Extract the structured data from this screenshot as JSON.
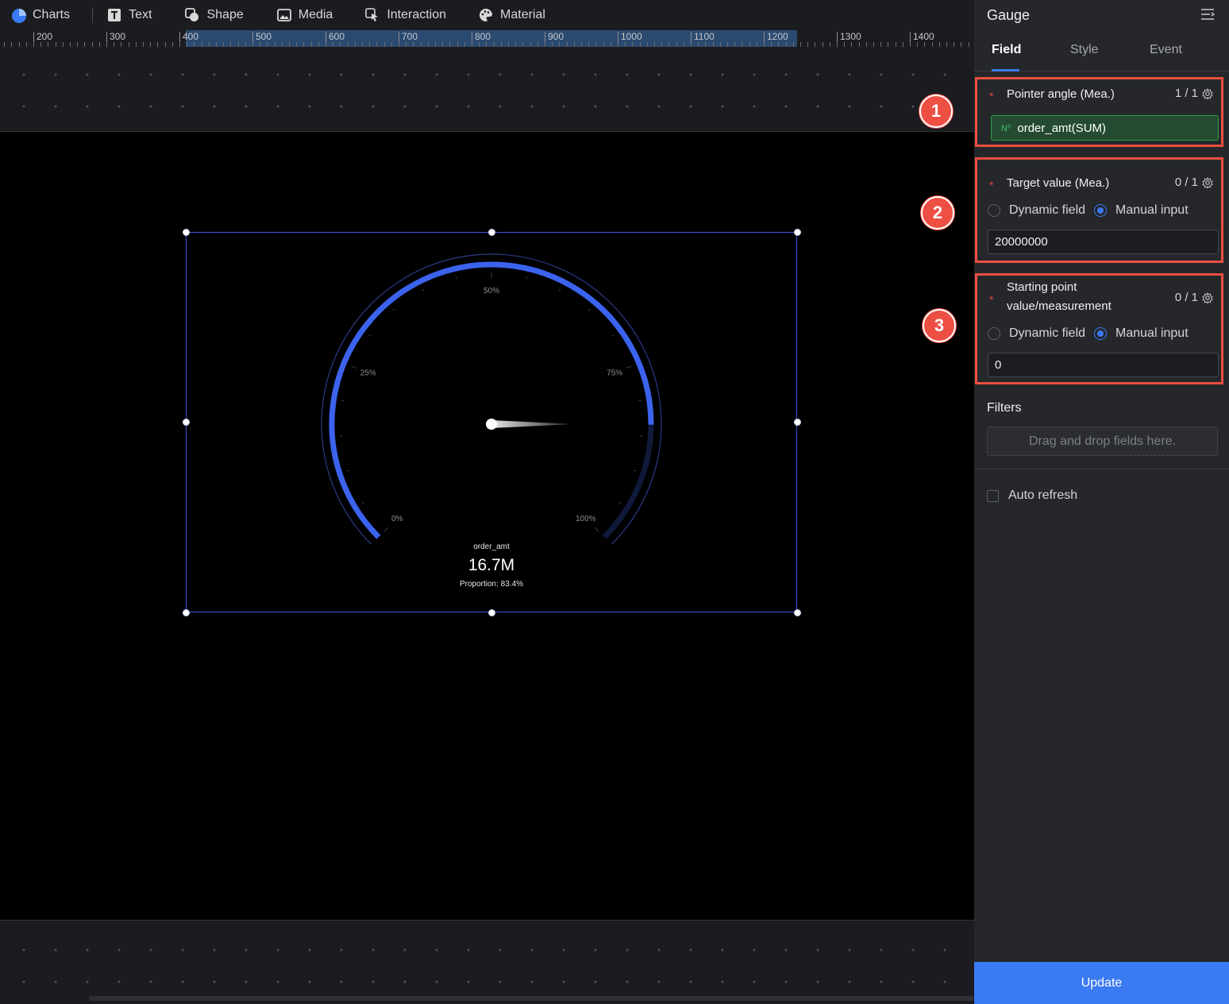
{
  "toolbar": {
    "items": [
      {
        "label": "Charts",
        "icon": "pie-chart-icon"
      },
      {
        "label": "Text",
        "icon": "text-icon"
      },
      {
        "label": "Shape",
        "icon": "shape-icon"
      },
      {
        "label": "Media",
        "icon": "image-icon"
      },
      {
        "label": "Interaction",
        "icon": "cursor-icon"
      },
      {
        "label": "Material",
        "icon": "palette-icon"
      }
    ]
  },
  "ruler": {
    "labels": [
      "200",
      "300",
      "400",
      "500",
      "600",
      "700",
      "800",
      "900",
      "1000",
      "1100",
      "1200",
      "1300",
      "1400"
    ]
  },
  "chart_data": {
    "type": "gauge",
    "title": "order_amt",
    "value_label": "16.7M",
    "proportion_label": "Proportion: 83.4%",
    "proportion": 0.834,
    "tick_labels": [
      "0%",
      "25%",
      "50%",
      "75%",
      "100%"
    ],
    "colors": {
      "progress": "#3b63ee",
      "track": "#0f1a3a",
      "outer_ring": "#2a3a8a"
    }
  },
  "badges": [
    "1",
    "2",
    "3"
  ],
  "panel": {
    "title": "Gauge",
    "tabs": [
      {
        "label": "Field",
        "active": true
      },
      {
        "label": "Style",
        "active": false
      },
      {
        "label": "Event",
        "active": false
      }
    ],
    "pointer": {
      "title": "Pointer angle (Mea.)",
      "count": "1 / 1",
      "field_prefix": "N⁰",
      "field": "order_amt(SUM)"
    },
    "target": {
      "title": "Target value (Mea.)",
      "count": "0 / 1",
      "option_dynamic": "Dynamic field",
      "option_manual": "Manual input",
      "selected": "Manual input",
      "value": "20000000"
    },
    "start": {
      "title_line1": "Starting point",
      "title_line2": "value/measurement",
      "count": "0 / 1",
      "option_dynamic": "Dynamic field",
      "option_manual": "Manual input",
      "selected": "Manual input",
      "value": "0"
    },
    "filters_label": "Filters",
    "dropzone": "Drag and drop fields here.",
    "auto_refresh": "Auto refresh",
    "update": "Update"
  },
  "colors": {
    "accent": "#3a7af2",
    "highlight": "#ee4f43",
    "field_green": "#2fa14f"
  }
}
